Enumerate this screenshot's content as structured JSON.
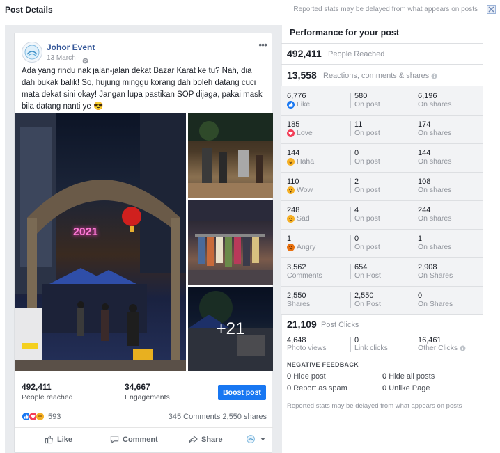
{
  "header": {
    "title": "Post Details",
    "note": "Reported stats may be delayed from what appears on posts"
  },
  "post": {
    "page_name": "Johor Event",
    "date": "13 March ·",
    "text": "Ada yang rindu nak jalan-jalan dekat Bazar Karat ke tu? Nah, dia dah bukak balik! So, hujung minggu korang dah boleh datang cuci mata dekat sini okay! Jangan lupa pastikan SOP dijaga, pakai mask bila datang nanti ye 😎",
    "photo_overlay": "+21",
    "photo_arch_text": "2021",
    "people_reached": "492,411",
    "people_reached_label": "People reached",
    "engagements": "34,667",
    "engagements_label": "Engagements",
    "boost_label": "Boost post",
    "reaction_count": "593",
    "comments_shares": "345 Comments  2,550 shares",
    "actions": {
      "like": "Like",
      "comment": "Comment",
      "share": "Share"
    }
  },
  "performance": {
    "title": "Performance for your post",
    "people_reached": "492,411",
    "people_reached_label": "People Reached",
    "reactions_total": "13,558",
    "reactions_total_label": "Reactions, comments & shares",
    "rows": [
      {
        "label": "Like",
        "icon": "like",
        "total": "6,776",
        "on_post": "580",
        "on_post_label": "On post",
        "on_shares": "6,196",
        "on_shares_label": "On shares"
      },
      {
        "label": "Love",
        "icon": "love",
        "total": "185",
        "on_post": "11",
        "on_post_label": "On post",
        "on_shares": "174",
        "on_shares_label": "On shares"
      },
      {
        "label": "Haha",
        "icon": "haha",
        "total": "144",
        "on_post": "0",
        "on_post_label": "On post",
        "on_shares": "144",
        "on_shares_label": "On shares"
      },
      {
        "label": "Wow",
        "icon": "wow",
        "total": "110",
        "on_post": "2",
        "on_post_label": "On post",
        "on_shares": "108",
        "on_shares_label": "On shares"
      },
      {
        "label": "Sad",
        "icon": "sad",
        "total": "248",
        "on_post": "4",
        "on_post_label": "On post",
        "on_shares": "244",
        "on_shares_label": "On shares"
      },
      {
        "label": "Angry",
        "icon": "angry",
        "total": "1",
        "on_post": "0",
        "on_post_label": "On post",
        "on_shares": "1",
        "on_shares_label": "On shares"
      },
      {
        "label": "Comments",
        "icon": "",
        "total": "3,562",
        "on_post": "654",
        "on_post_label": "On Post",
        "on_shares": "2,908",
        "on_shares_label": "On Shares"
      },
      {
        "label": "Shares",
        "icon": "",
        "total": "2,550",
        "on_post": "2,550",
        "on_post_label": "On Post",
        "on_shares": "0",
        "on_shares_label": "On Shares"
      }
    ],
    "post_clicks": "21,109",
    "post_clicks_label": "Post Clicks",
    "photo_views": "4,648",
    "photo_views_label": "Photo views",
    "link_clicks": "0",
    "link_clicks_label": "Link clicks",
    "other_clicks": "16,461",
    "other_clicks_label": "Other Clicks",
    "negative_title": "NEGATIVE FEEDBACK",
    "negative": {
      "hide_post_count": "0",
      "hide_post_label": "Hide post",
      "hide_all_count": "0",
      "hide_all_label": "Hide all posts",
      "spam_count": "0",
      "spam_label": "Report as spam",
      "unlike_count": "0",
      "unlike_label": "Unlike Page"
    },
    "footer_note": "Reported stats may be delayed from what appears on posts"
  },
  "colors": {
    "accent": "#1877f2",
    "link": "#365899",
    "like": "#1877f2",
    "love": "#f33e58",
    "haha": "#f7b125",
    "angry": "#e9710f"
  }
}
